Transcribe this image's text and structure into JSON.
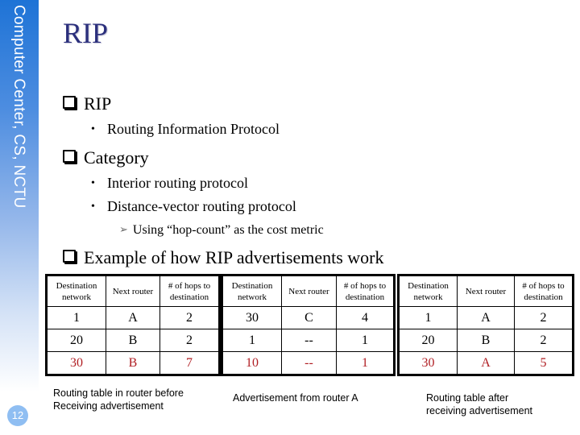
{
  "sidebar": {
    "text": "Computer Center, CS, NCTU",
    "page_number": "12",
    "gradient_top": "#1e73d6",
    "page_badge_color": "#8fbef2"
  },
  "slide": {
    "title": "RIP",
    "title_color": "#2b2f7c",
    "bullets": [
      {
        "label": "RIP",
        "sub": [
          "Routing Information Protocol"
        ]
      },
      {
        "label": "Category",
        "sub": [
          "Interior routing protocol",
          "Distance-vector routing protocol"
        ],
        "subsub": "Using “hop-count” as the cost metric"
      },
      {
        "label": "Example of how RIP advertisements work"
      }
    ]
  },
  "tables": [
    {
      "headers": [
        "Destination network",
        "Next router",
        "# of hops to destination"
      ],
      "rows": [
        [
          "1",
          "A",
          "2"
        ],
        [
          "20",
          "B",
          "2"
        ],
        [
          "30",
          "B",
          "7"
        ]
      ],
      "highlight_row": 2,
      "caption_lines": [
        "Routing table in router before",
        "Receiving advertisement"
      ]
    },
    {
      "headers": [
        "Destination network",
        "Next router",
        "# of hops to destination"
      ],
      "rows": [
        [
          "30",
          "C",
          "4"
        ],
        [
          "1",
          "--",
          "1"
        ],
        [
          "10",
          "--",
          "1"
        ]
      ],
      "highlight_row": 2,
      "caption_lines": [
        "Advertisement from router A"
      ]
    },
    {
      "headers": [
        "Destination network",
        "Next router",
        "# of hops to destination"
      ],
      "rows": [
        [
          "1",
          "A",
          "2"
        ],
        [
          "20",
          "B",
          "2"
        ],
        [
          "30",
          "A",
          "5"
        ]
      ],
      "highlight_row": 2,
      "caption_lines": [
        "Routing table after",
        "receiving advertisement"
      ]
    }
  ],
  "highlight_color": "#b01e23"
}
